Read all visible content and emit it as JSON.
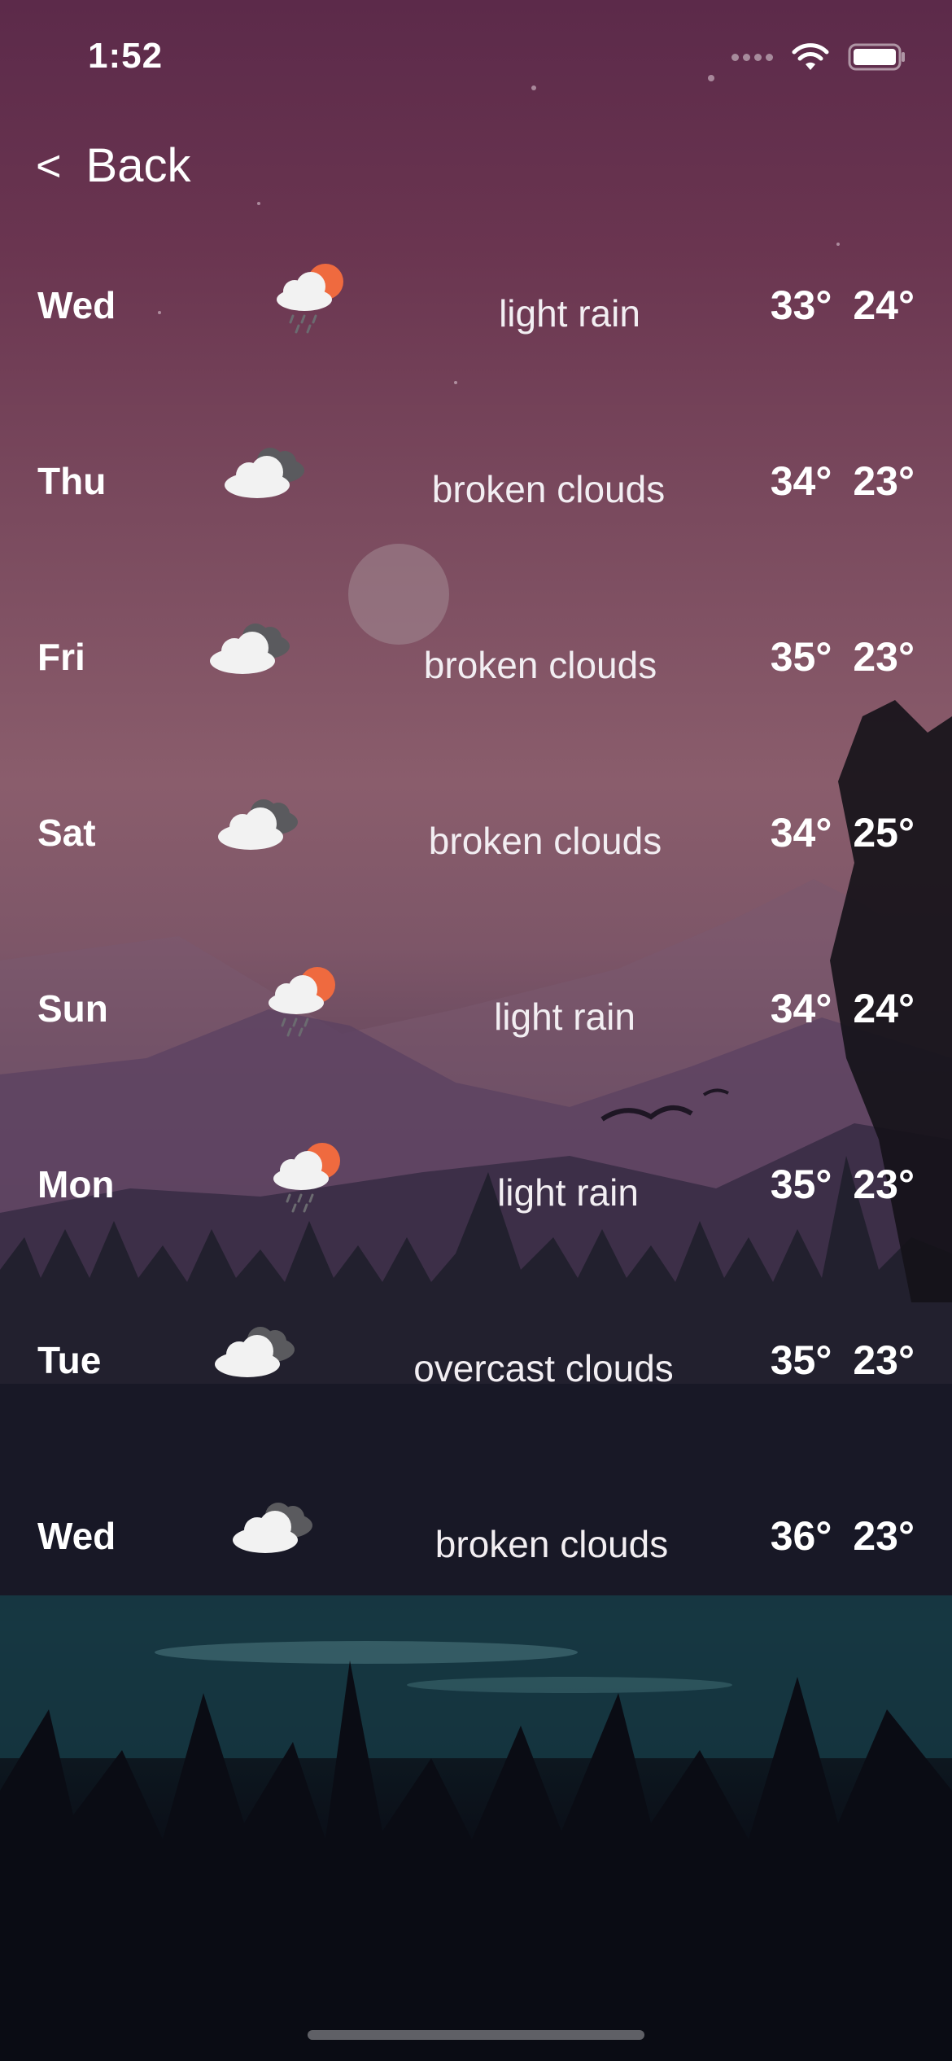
{
  "status_bar": {
    "time": "1:52",
    "icons": [
      "cellular-signal-icon",
      "wifi-icon",
      "battery-icon"
    ]
  },
  "nav": {
    "back_chevron": "<",
    "back_label": "Back"
  },
  "colors": {
    "sun": "#ef6a3f",
    "cloud_front": "#f2f2f2",
    "cloud_back": "#5a5a5e",
    "rain": "#6b6b70"
  },
  "forecast": [
    {
      "day": "Wed",
      "icon": "light-rain-icon",
      "description": "light rain",
      "high": "33°",
      "low": "24°"
    },
    {
      "day": "Thu",
      "icon": "broken-clouds-icon",
      "description": "broken clouds",
      "high": "34°",
      "low": "23°"
    },
    {
      "day": "Fri",
      "icon": "broken-clouds-icon",
      "description": "broken clouds",
      "high": "35°",
      "low": "23°"
    },
    {
      "day": "Sat",
      "icon": "broken-clouds-icon",
      "description": "broken clouds",
      "high": "34°",
      "low": "25°"
    },
    {
      "day": "Sun",
      "icon": "light-rain-icon",
      "description": "light rain",
      "high": "34°",
      "low": "24°"
    },
    {
      "day": "Mon",
      "icon": "light-rain-icon",
      "description": "light rain",
      "high": "35°",
      "low": "23°"
    },
    {
      "day": "Tue",
      "icon": "overcast-clouds-icon",
      "description": "overcast clouds",
      "high": "35°",
      "low": "23°"
    },
    {
      "day": "Wed",
      "icon": "broken-clouds-icon",
      "description": "broken clouds",
      "high": "36°",
      "low": "23°"
    }
  ]
}
